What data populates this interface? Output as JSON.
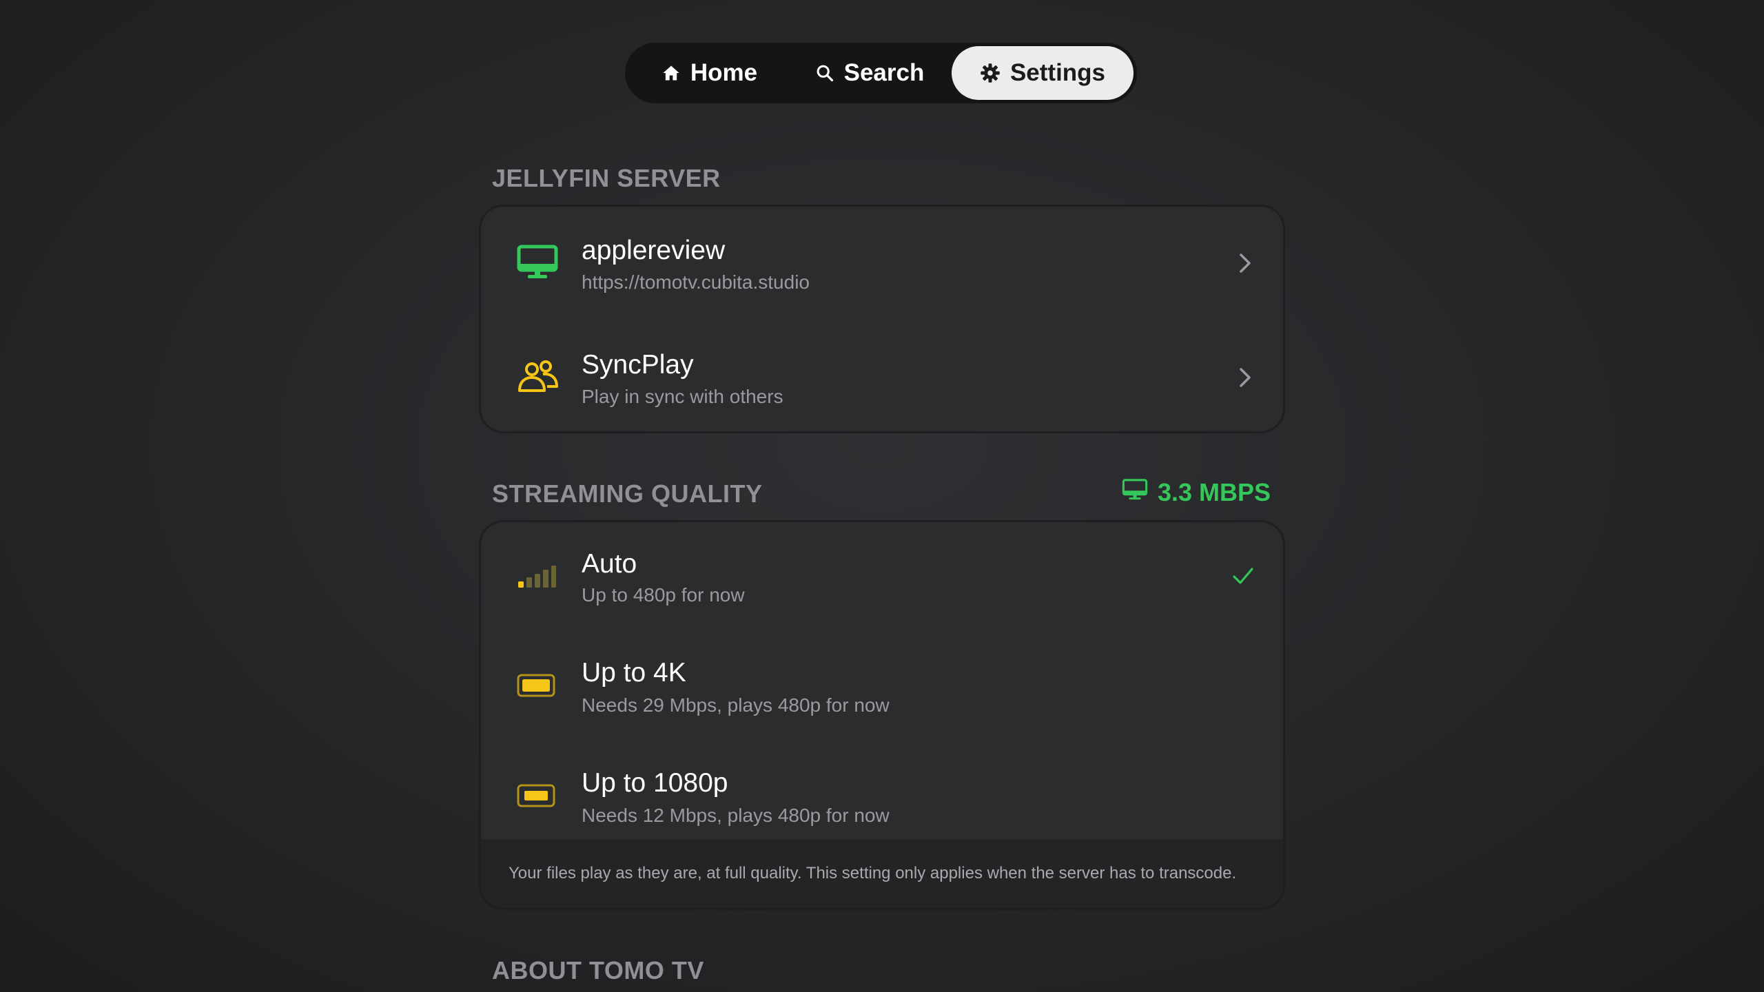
{
  "nav": {
    "home_label": "Home",
    "search_label": "Search",
    "settings_label": "Settings",
    "active": "Settings"
  },
  "server_section": {
    "title": "JELLYFIN SERVER",
    "items": [
      {
        "title": "applereview",
        "subtitle": "https://tomotv.cubita.studio",
        "icon": "monitor-icon"
      },
      {
        "title": "SyncPlay",
        "subtitle": "Play in sync with others",
        "icon": "people-icon"
      }
    ]
  },
  "quality_section": {
    "title": "STREAMING QUALITY",
    "bitrate_label": "3.3 MBPS",
    "items": [
      {
        "title": "Auto",
        "subtitle": "Up to 480p for now",
        "icon": "signal-bars-icon",
        "selected": true
      },
      {
        "title": "Up to 4K",
        "subtitle": "Needs 29 Mbps, plays 480p for now",
        "icon": "battery-icon",
        "selected": false
      },
      {
        "title": "Up to 1080p",
        "subtitle": "Needs 12 Mbps, plays 480p for now",
        "icon": "battery-icon",
        "selected": false
      }
    ],
    "note": "Your files play as they are, at full quality. This setting only applies when the server has to transcode."
  },
  "about_section": {
    "title": "ABOUT TOMO TV"
  },
  "colors": {
    "green": "#34c759",
    "yellow": "#f5c518",
    "card": "#2b2c2e",
    "nav_active": "#ececec"
  }
}
